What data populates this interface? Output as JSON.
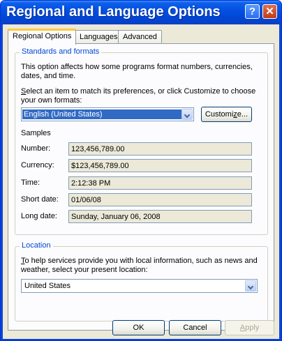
{
  "window": {
    "title": "Regional and Language Options",
    "help_glyph": "?",
    "close_glyph": "✕"
  },
  "tabs": [
    {
      "label": "Regional Options",
      "active": true
    },
    {
      "label": "Languages",
      "active": false
    },
    {
      "label": "Advanced",
      "active": false
    }
  ],
  "standards": {
    "legend": "Standards and formats",
    "description_line1": "This option affects how some programs format numbers, currencies,",
    "description_line2": "dates, and time.",
    "select_line1_prefix": "S",
    "select_line1_rest": "elect an item to match its preferences, or click Customize to choose",
    "select_line2": "your own formats:",
    "format_value": "English (United States)",
    "customize_prefix": "Customi",
    "customize_accel": "z",
    "customize_suffix": "e..."
  },
  "samples": {
    "heading": "Samples",
    "rows": [
      {
        "label": "Number:",
        "value": "123,456,789.00"
      },
      {
        "label": "Currency:",
        "value": "$123,456,789.00"
      },
      {
        "label": "Time:",
        "value": "2:12:38 PM"
      },
      {
        "label": "Short date:",
        "value": "01/06/08"
      },
      {
        "label": "Long date:",
        "value": "Sunday, January 06, 2008"
      }
    ]
  },
  "location": {
    "legend": "Location",
    "text_line1_prefix": "T",
    "text_line1_rest": "o help services provide you with local information, such as news and",
    "text_line2": "weather, select your present location:",
    "value": "United States"
  },
  "buttons": {
    "ok": "OK",
    "cancel": "Cancel",
    "apply_accel": "A",
    "apply_rest": "pply"
  }
}
